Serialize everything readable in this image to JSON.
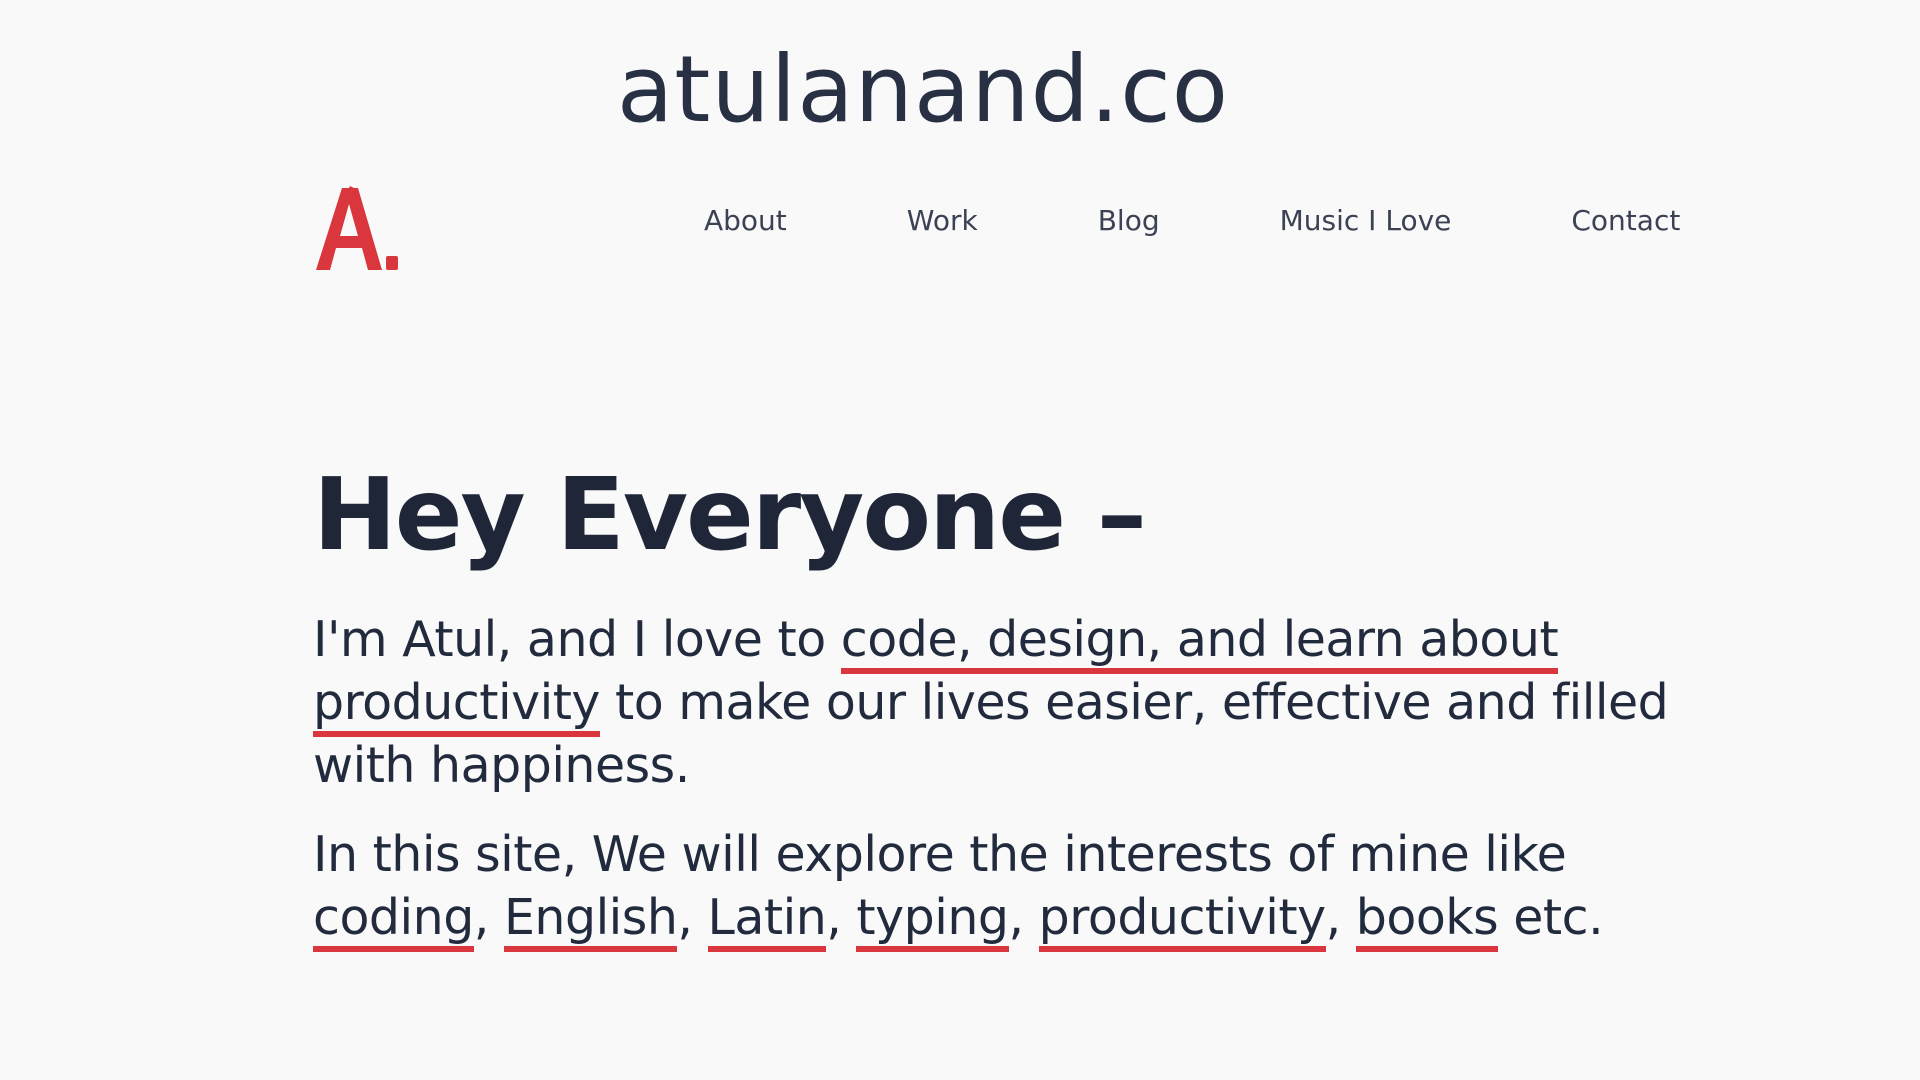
{
  "site_title": "atulanand.co",
  "logo": {
    "icon": "logo-a-icon",
    "color": "#d9363e"
  },
  "nav": {
    "about": "About",
    "work": "Work",
    "blog": "Blog",
    "music": "Music I Love",
    "contact": "Contact"
  },
  "hero": {
    "heading": "Hey Everyone –",
    "intro_prefix": "I'm Atul, and I love to ",
    "intro_link_1": "code, design, and learn about productivity",
    "intro_suffix": " to make our lives easier, effective and filled with happiness.",
    "interests_prefix": "In this site, We will explore the interests of mine like ",
    "interest_links": [
      "coding",
      "English",
      "Latin",
      "typing",
      "productivity",
      "books"
    ],
    "interests_separator": ", ",
    "interests_suffix": " etc."
  },
  "colors": {
    "accent": "#d9363e",
    "text": "#222b3d",
    "background": "#f9f9f9"
  }
}
